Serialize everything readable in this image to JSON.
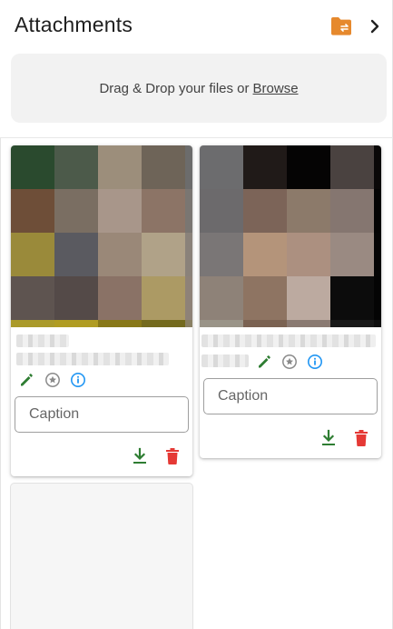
{
  "header": {
    "title": "Attachments",
    "folder_icon": "folder-swap-icon",
    "collapse_icon": "chevron-right-icon",
    "accent": "#e6892d"
  },
  "dropzone": {
    "text": "Drag & Drop your files or",
    "browse_label": "Browse"
  },
  "attachments": [
    {
      "caption_placeholder": "Caption",
      "icons": [
        "pencil-icon",
        "star-icon",
        "info-icon",
        "download-icon",
        "delete-icon"
      ],
      "thumbnail_colors": [
        [
          "#2a4a2e",
          "#4c5a4a",
          "#9c8e7b",
          "#6e6458",
          "#6c6c6c"
        ],
        [
          "#6e4e38",
          "#7a6e62",
          "#a8968a",
          "#8c7466",
          "#7a7672"
        ],
        [
          "#9a8a3a",
          "#5a5a60",
          "#9a8878",
          "#b0a288",
          "#8a827a"
        ],
        [
          "#5e5450",
          "#544a48",
          "#8a7266",
          "#ac9a64",
          "#8e8278"
        ],
        [
          "#aa9a2a",
          "#b09c22",
          "#887818",
          "#746a1e",
          "#8a8064"
        ]
      ]
    },
    {
      "caption_placeholder": "Caption",
      "icons": [
        "pencil-icon",
        "star-icon",
        "info-icon",
        "download-icon",
        "delete-icon"
      ],
      "thumbnail_colors": [
        [
          "#6c6c6e",
          "#201a18",
          "#050404",
          "#4a4240",
          "#0a0808"
        ],
        [
          "#6c6a6c",
          "#7c6458",
          "#8c7a6a",
          "#857670",
          "#040404"
        ],
        [
          "#7a7676",
          "#b4947a",
          "#ac9080",
          "#9a8a82",
          "#050505"
        ],
        [
          "#8e8278",
          "#8e7462",
          "#bcaaa0",
          "#0c0c0c",
          "#040404"
        ],
        [
          "#9a9488",
          "#7a6252",
          "#8a7a72",
          "#1a1a1a",
          "#101010"
        ]
      ]
    }
  ],
  "colors": {
    "edit_green": "#2e7d32",
    "info_blue": "#2196f3",
    "delete_red": "#e53935",
    "star_grey": "#8a8a8a"
  }
}
